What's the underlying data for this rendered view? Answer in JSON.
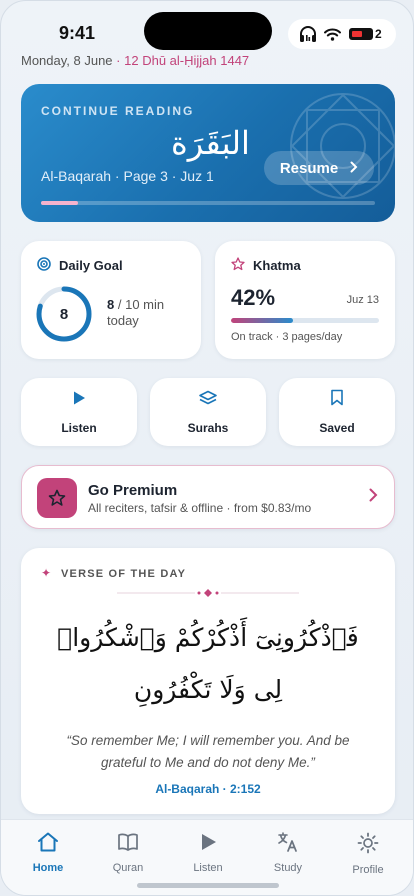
{
  "status": {
    "time": "9:41",
    "battery": "2"
  },
  "date": {
    "gregorian": "Monday, 8 June",
    "separator": "·",
    "hijri": "12 Dhū al-Ḥijjah 1447"
  },
  "hero": {
    "label": "CONTINUE READING",
    "arabic": "البَقَرَة",
    "subtitle": "Al-Baqarah · Page 3 · Juz 1",
    "progress": 0.11,
    "resume_label": "Resume",
    "chevron_icon": "chevron-right-icon"
  },
  "daily_goal": {
    "title": "Daily Goal",
    "icon": "target-icon",
    "ring_value": "8",
    "progress": 0.8,
    "done": "8",
    "total": "/ 10 min",
    "period": "today",
    "accent": "#1a76b8"
  },
  "khatma": {
    "title": "Khatma",
    "icon": "star-outline-icon",
    "percent": "42%",
    "progress": 0.42,
    "juz": "Juz 13",
    "status": "On track · 3 pages/day"
  },
  "quick_actions": [
    {
      "label": "Listen",
      "icon": "play-icon"
    },
    {
      "label": "Surahs",
      "icon": "layers-icon"
    },
    {
      "label": "Saved",
      "icon": "bookmark-icon"
    }
  ],
  "premium": {
    "title": "Go Premium",
    "subtitle": "All reciters, tafsir & offline · from $0.83/mo",
    "icon": "star-icon",
    "accent": "#c2437a"
  },
  "verse": {
    "label": "VERSE OF THE DAY",
    "arabic": "فَٱذْكُرُونِىٓ أَذْكُرْكُمْ وَٱشْكُرُوا۟ لِى وَلَا تَكْفُرُونِ",
    "translation": "“So remember Me; I will remember you. And be grateful to Me and do not deny Me.”",
    "reference": "Al-Baqarah · 2:152"
  },
  "tabs": [
    {
      "label": "Home",
      "icon": "home-icon",
      "active": true
    },
    {
      "label": "Quran",
      "icon": "book-icon",
      "active": false
    },
    {
      "label": "Listen",
      "icon": "play-icon",
      "active": false
    },
    {
      "label": "Study",
      "icon": "translate-icon",
      "active": false
    },
    {
      "label": "Profile",
      "icon": "gear-icon",
      "active": false
    }
  ],
  "colors": {
    "primary": "#1a76b8",
    "accent": "#c2437a",
    "background": "#eef3f8"
  }
}
